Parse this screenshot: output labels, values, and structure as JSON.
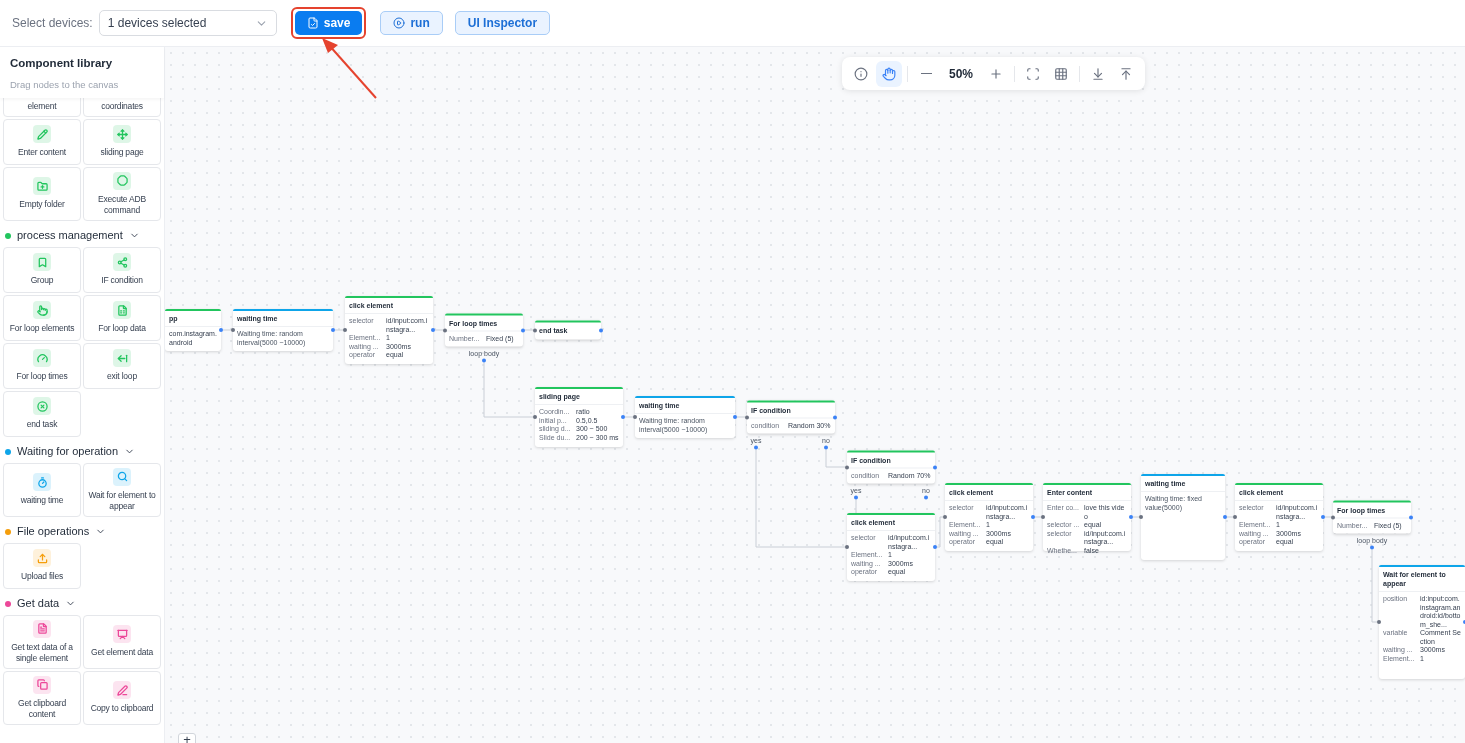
{
  "topbar": {
    "device_label": "Select devices:",
    "device_select": "1 devices selected",
    "buttons": [
      {
        "label": "save",
        "kind": "primary",
        "highlighted": true
      },
      {
        "label": "run",
        "kind": "secondary",
        "highlighted": false
      },
      {
        "label": "UI Inspector",
        "kind": "secondary",
        "highlighted": false
      }
    ]
  },
  "sidebar": {
    "title": "Component library",
    "subtitle": "Drag nodes to the canvas",
    "groups": [
      {
        "color": "#22c55e",
        "items": [
          "element",
          "coordinates",
          "Enter content",
          "sliding page",
          "Empty folder",
          "Execute ADB command"
        ]
      },
      {
        "title": "process management",
        "color": "#22c55e",
        "expanded": true,
        "items": [
          "Group",
          "IF condition",
          "For loop elements",
          "For loop data",
          "For loop times",
          "exit loop",
          "end task"
        ]
      },
      {
        "title": "Waiting for operation",
        "color": "#0ea5e9",
        "expanded": true,
        "items": [
          "waiting time",
          "Wait for element to appear"
        ]
      },
      {
        "title": "File operations",
        "color": "#f59e0b",
        "expanded": true,
        "items": [
          "Upload files"
        ]
      },
      {
        "title": "Get data",
        "color": "#ec4899",
        "expanded": true,
        "items": [
          "Get text data of a single element",
          "Get element data",
          "Get clipboard content",
          "Copy to clipboard"
        ]
      }
    ]
  },
  "toolbar": {
    "tools": [
      {
        "kind": "info",
        "selected": false
      },
      {
        "kind": "hand",
        "selected": true
      },
      {
        "kind": "zoom-out",
        "selected": false
      },
      {
        "kind": "zoom-in",
        "selected": false
      },
      {
        "kind": "fit",
        "selected": false
      },
      {
        "kind": "grid",
        "selected": false
      },
      {
        "kind": "import",
        "selected": false
      },
      {
        "kind": "export",
        "selected": false
      }
    ],
    "zoom": "50%"
  },
  "canvas": {
    "corner_button": "+",
    "nodes": [
      {
        "title": "pp",
        "color": "#22c55e",
        "rows": [
          {
            "value": "com.instagram.android"
          }
        ]
      },
      {
        "title": "waiting time",
        "color": "#0ea5e9",
        "text": "Waiting time: random interval(5000 ~10000)"
      },
      {
        "title": "click element",
        "color": "#22c55e",
        "rows": [
          {
            "label": "selector",
            "value": "id/input:com.instagra..."
          },
          {
            "label": "Element...",
            "value": "1"
          },
          {
            "label": "waiting ...",
            "value": "3000ms"
          },
          {
            "label": "operator",
            "value": "equal"
          }
        ]
      },
      {
        "title": "For loop times",
        "color": "#22c55e",
        "rows": [
          {
            "label": "Number...",
            "value": "Fixed (5)"
          }
        ],
        "branches": [
          "loop body"
        ]
      },
      {
        "title": "end task",
        "color": "#22c55e"
      },
      {
        "title": "sliding page",
        "color": "#22c55e",
        "rows": [
          {
            "label": "Coordin...",
            "value": "ratio"
          },
          {
            "label": "initial p...",
            "value": "0.5,0.5"
          },
          {
            "label": "sliding d...",
            "value": "300 ~ 500"
          },
          {
            "label": "Slide du...",
            "value": "200 ~ 300 ms"
          }
        ]
      },
      {
        "title": "waiting time",
        "color": "#0ea5e9",
        "text": "Waiting time: random interval(5000 ~10000)"
      },
      {
        "title": "IF condition",
        "color": "#22c55e",
        "rows": [
          {
            "label": "condition",
            "value": "Random 30%"
          }
        ],
        "branches": [
          "yes",
          "no"
        ]
      },
      {
        "title": "IF condition",
        "color": "#22c55e",
        "rows": [
          {
            "label": "condition",
            "value": "Random 70%"
          }
        ],
        "branches": [
          "yes",
          "no"
        ]
      },
      {
        "title": "click element",
        "color": "#22c55e",
        "rows": [
          {
            "label": "selector",
            "value": "id/input:com.instagra..."
          },
          {
            "label": "Element...",
            "value": "1"
          },
          {
            "label": "waiting ...",
            "value": "3000ms"
          },
          {
            "label": "operator",
            "value": "equal"
          }
        ]
      },
      {
        "title": "click element",
        "color": "#22c55e",
        "rows": [
          {
            "label": "selector",
            "value": "id/input:com.instagra..."
          },
          {
            "label": "Element...",
            "value": "1"
          },
          {
            "label": "waiting ...",
            "value": "3000ms"
          },
          {
            "label": "operator",
            "value": "equal"
          }
        ]
      },
      {
        "title": "Enter content",
        "color": "#22c55e",
        "rows": [
          {
            "label": "Enter co...",
            "value": "love this video"
          },
          {
            "label": "selector ...",
            "value": "equal"
          },
          {
            "label": "selector",
            "value": "id/input:com.instagra..."
          },
          {
            "label": "Whethe...",
            "value": "false"
          }
        ]
      },
      {
        "title": "waiting time",
        "color": "#0ea5e9",
        "text": "Waiting time: fixed value(5000)"
      },
      {
        "title": "click element",
        "color": "#22c55e",
        "rows": [
          {
            "label": "selector",
            "value": "id/input:com.instagra..."
          },
          {
            "label": "Element...",
            "value": "1"
          },
          {
            "label": "waiting ...",
            "value": "3000ms"
          },
          {
            "label": "operator",
            "value": "equal"
          }
        ]
      },
      {
        "title": "For loop times",
        "color": "#22c55e",
        "rows": [
          {
            "label": "Number...",
            "value": "Fixed (5)"
          }
        ],
        "branches": [
          "loop body"
        ]
      },
      {
        "title": "Wait for element to appear",
        "color": "#0ea5e9",
        "rows": [
          {
            "label": "position",
            "value": "id:input:com.instagram.android:id/bottom_she..."
          },
          {
            "label": "variable",
            "value": "Comment Section"
          },
          {
            "label": "waiting ...",
            "value": "3000ms"
          },
          {
            "label": "Element...",
            "value": "1"
          }
        ]
      }
    ]
  }
}
